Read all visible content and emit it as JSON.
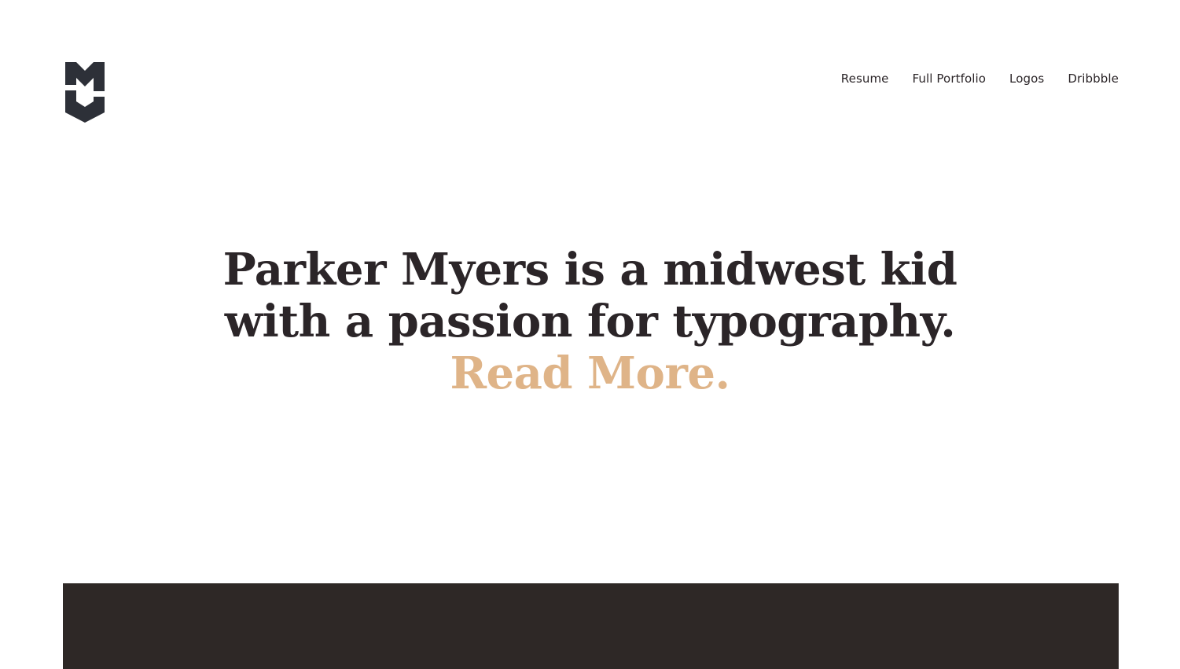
{
  "logo": {
    "icon": "mk-monogram-logo",
    "color": "#2d3038"
  },
  "nav": {
    "items": [
      {
        "label": "Resume"
      },
      {
        "label": "Full Portfolio"
      },
      {
        "label": "Logos"
      },
      {
        "label": "Dribbble"
      }
    ]
  },
  "hero": {
    "line1": "Parker Myers is a midwest kid",
    "line2": "with a passion for typography.",
    "read_more": "Read More.",
    "text_color": "#2b2528",
    "accent_color": "#dfb488"
  },
  "panel": {
    "color": "#2e2826"
  }
}
